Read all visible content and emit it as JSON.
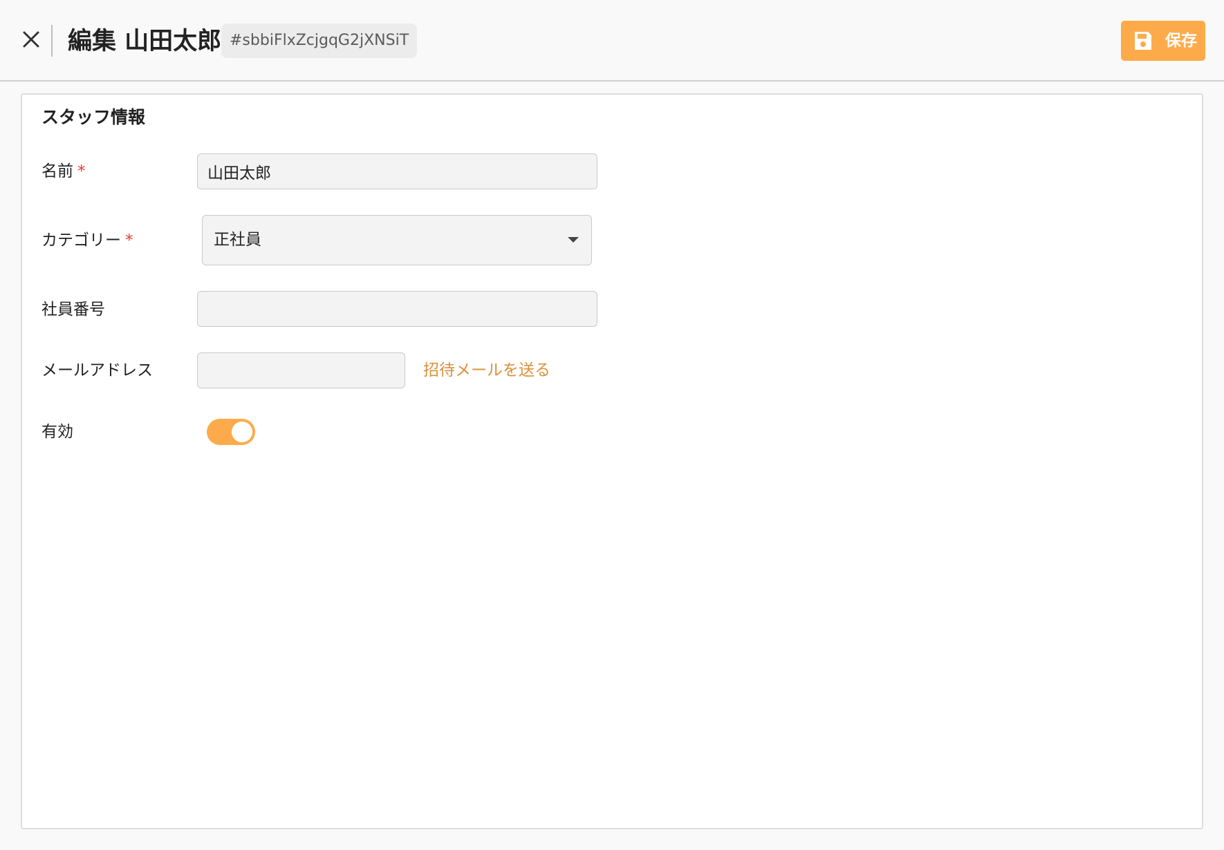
{
  "header": {
    "title": "編集 山田太郎",
    "record_id": "#sbbiFlxZcjgqG2jXNSiT",
    "save_label": "保存"
  },
  "card": {
    "title": "スタッフ情報"
  },
  "form": {
    "name": {
      "label": "名前",
      "required_mark": "*",
      "value": "山田太郎"
    },
    "category": {
      "label": "カテゴリー",
      "required_mark": "*",
      "selected": "正社員"
    },
    "employee_number": {
      "label": "社員番号",
      "value": ""
    },
    "email": {
      "label": "メールアドレス",
      "value": "",
      "invite_link": "招待メールを送る"
    },
    "active": {
      "label": "有効",
      "enabled": true
    }
  },
  "colors": {
    "accent": "#fdab4a",
    "link": "#d9913c",
    "required": "#e53935"
  }
}
